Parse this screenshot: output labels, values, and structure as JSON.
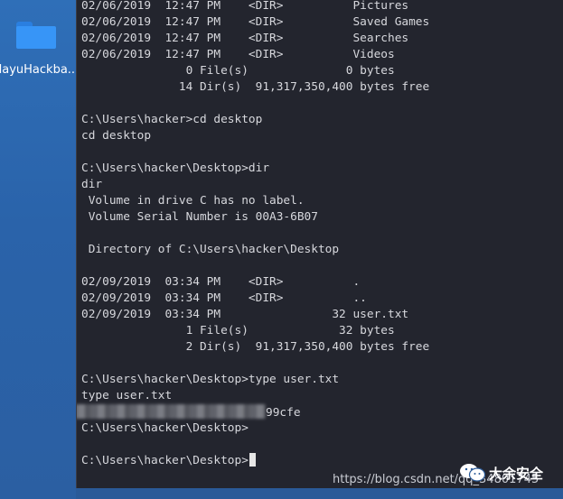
{
  "desktop": {
    "icon_label": "dayuHackba..."
  },
  "terminal": {
    "lines": [
      "02/06/2019  12:47 PM    <DIR>          Pictures",
      "02/06/2019  12:47 PM    <DIR>          Saved Games",
      "02/06/2019  12:47 PM    <DIR>          Searches",
      "02/06/2019  12:47 PM    <DIR>          Videos",
      "               0 File(s)              0 bytes",
      "              14 Dir(s)  91,317,350,400 bytes free",
      "",
      "C:\\Users\\hacker>cd desktop",
      "cd desktop",
      "",
      "C:\\Users\\hacker\\Desktop>dir",
      "dir",
      " Volume in drive C has no label.",
      " Volume Serial Number is 00A3-6B07",
      "",
      " Directory of C:\\Users\\hacker\\Desktop",
      "",
      "02/09/2019  03:34 PM    <DIR>          .",
      "02/09/2019  03:34 PM    <DIR>          ..",
      "02/09/2019  03:34 PM                32 user.txt",
      "               1 File(s)             32 bytes",
      "               2 Dir(s)  91,317,350,400 bytes free",
      "",
      "C:\\Users\\hacker\\Desktop>type user.txt",
      "type user.txt",
      "",
      "C:\\Users\\hacker\\Desktop>",
      "",
      "C:\\Users\\hacker\\Desktop>"
    ],
    "redacted_suffix": "99cfe"
  },
  "watermark": {
    "url_text": "https://blog.csdn.net/qq_34801745",
    "brand_text": "大余安全"
  }
}
